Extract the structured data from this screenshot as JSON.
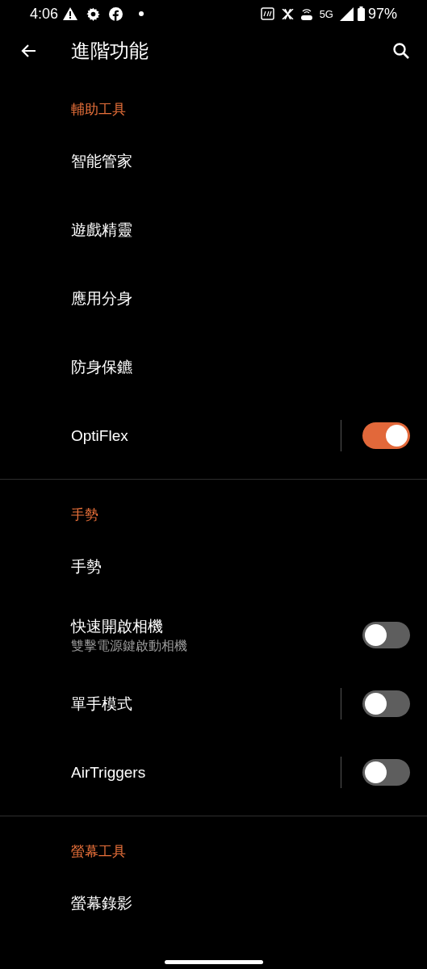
{
  "status_bar": {
    "time": "4:06",
    "network": "5G",
    "battery": "97%"
  },
  "toolbar": {
    "title": "進階功能"
  },
  "sections": [
    {
      "header": "輔助工具",
      "items": [
        {
          "kind": "plain",
          "title": "智能管家"
        },
        {
          "kind": "plain",
          "title": "遊戲精靈"
        },
        {
          "kind": "plain",
          "title": "應用分身"
        },
        {
          "kind": "plain",
          "title": "防身保鑣"
        },
        {
          "kind": "toggle",
          "title": "OptiFlex",
          "on": true,
          "separator": true
        }
      ]
    },
    {
      "header": "手勢",
      "items": [
        {
          "kind": "plain",
          "title": "手勢"
        },
        {
          "kind": "toggle",
          "title": "快速開啟相機",
          "summary": "雙擊電源鍵啟動相機",
          "on": false,
          "separator": false
        },
        {
          "kind": "toggle",
          "title": "單手模式",
          "on": false,
          "separator": true
        },
        {
          "kind": "toggle",
          "title": "AirTriggers",
          "on": false,
          "separator": true
        }
      ]
    },
    {
      "header": "螢幕工具",
      "items": [
        {
          "kind": "plain",
          "title": "螢幕錄影"
        }
      ]
    }
  ]
}
